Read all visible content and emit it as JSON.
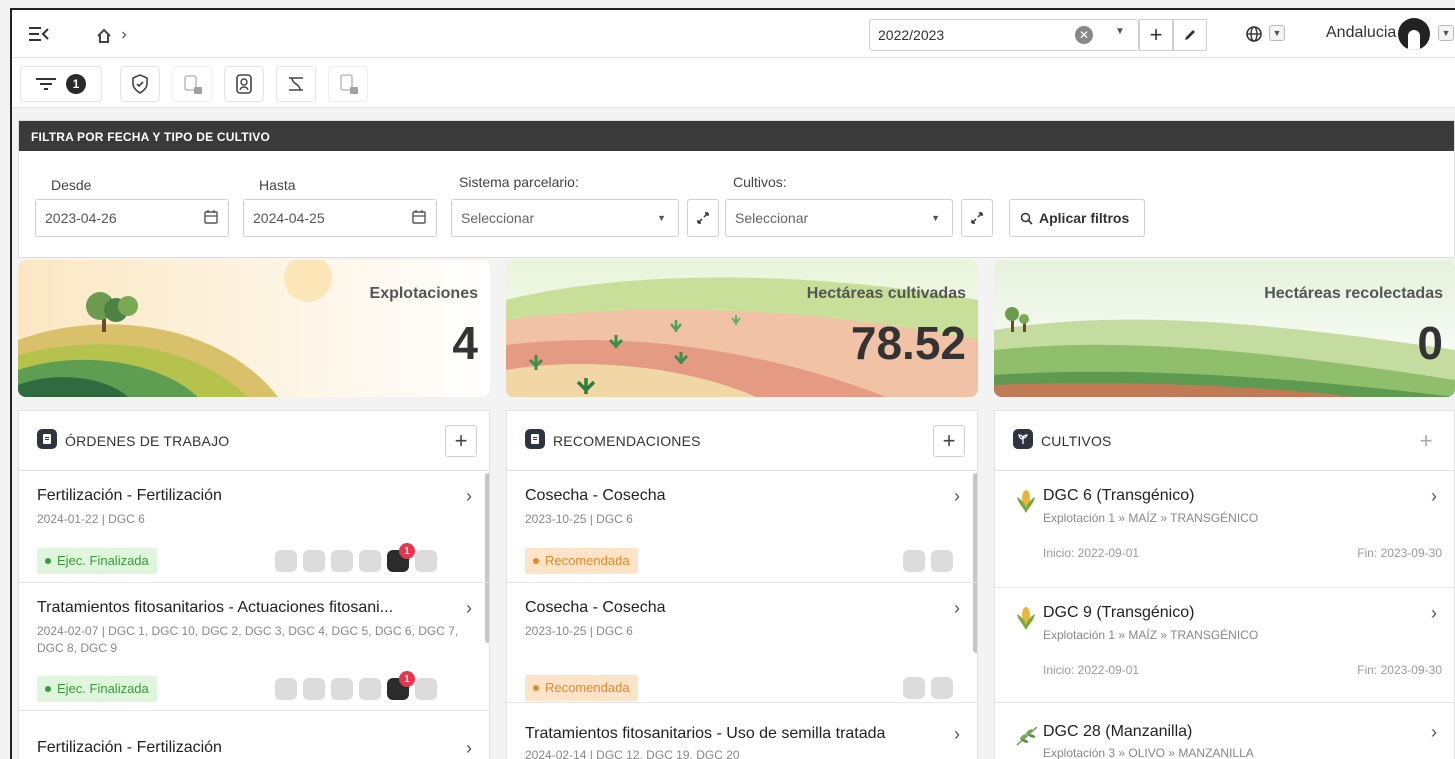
{
  "topbar": {
    "campaign_value": "2022/2023",
    "user_name": "Andalucia"
  },
  "toolbar": {
    "filter_count": "1"
  },
  "filter": {
    "title": "FILTRA POR FECHA Y TIPO DE CULTIVO",
    "desde_label": "Desde",
    "desde_value": "2023-04-26",
    "hasta_label": "Hasta",
    "hasta_value": "2024-04-25",
    "sistema_label": "Sistema parcelario:",
    "sistema_placeholder": "Seleccionar",
    "cultivos_label": "Cultivos:",
    "cultivos_placeholder": "Seleccionar",
    "apply_label": "Aplicar filtros"
  },
  "stats": [
    {
      "label": "Explotaciones",
      "value": "4"
    },
    {
      "label": "Hectáreas cultivadas",
      "value": "78.52"
    },
    {
      "label": "Hectáreas recolectadas",
      "value": "0"
    }
  ],
  "ordenes": {
    "title": "ÓRDENES DE TRABAJO",
    "items": [
      {
        "title": "Fertilización - Fertilización",
        "sub": "2024-01-22 | DGC 6",
        "status": "Ejec. Finalizada",
        "notif": "1"
      },
      {
        "title": "Tratamientos fitosanitarios - Actuaciones fitosani...",
        "sub": "2024-02-07 | DGC 1, DGC 10, DGC 2, DGC 3, DGC 4, DGC 5, DGC 6, DGC 7, DGC 8, DGC 9",
        "status": "Ejec. Finalizada",
        "notif": "1"
      },
      {
        "title": "Fertilización - Fertilización"
      }
    ]
  },
  "recomendaciones": {
    "title": "RECOMENDACIONES",
    "items": [
      {
        "title": "Cosecha - Cosecha",
        "sub": "2023-10-25 | DGC 6",
        "status": "Recomendada"
      },
      {
        "title": "Cosecha - Cosecha",
        "sub": "2023-10-25 | DGC 6",
        "status": "Recomendada"
      },
      {
        "title": "Tratamientos fitosanitarios - Uso de semilla tratada",
        "sub": "2024-02-14 | DGC 12, DGC 19, DGC 20"
      }
    ]
  },
  "cultivos": {
    "title": "CULTIVOS",
    "items": [
      {
        "title": "DGC 6 (Transgénico)",
        "sub": "Explotación 1 » MAÍZ » TRANSGÉNICO",
        "inicio": "Inicio: 2022-09-01",
        "fin": "Fin: 2023-09-30",
        "icon": "corn-icon"
      },
      {
        "title": "DGC 9 (Transgénico)",
        "sub": "Explotación 1 » MAÍZ » TRANSGÉNICO",
        "inicio": "Inicio: 2022-09-01",
        "fin": "Fin: 2023-09-30",
        "icon": "corn-icon"
      },
      {
        "title": "DGC 28 (Manzanilla)",
        "sub": "Explotación 3 » OLIVO » MANZANILLA",
        "icon": "olive-branch-icon"
      }
    ]
  },
  "colors": {
    "green_badge_bg": "#dff5dc",
    "green_badge_text": "#3a9a3a",
    "orange_badge_bg": "#fde4c8",
    "orange_badge_text": "#e08a2a",
    "header_dark": "#3a3a3a",
    "notif_red": "#e8364f"
  }
}
